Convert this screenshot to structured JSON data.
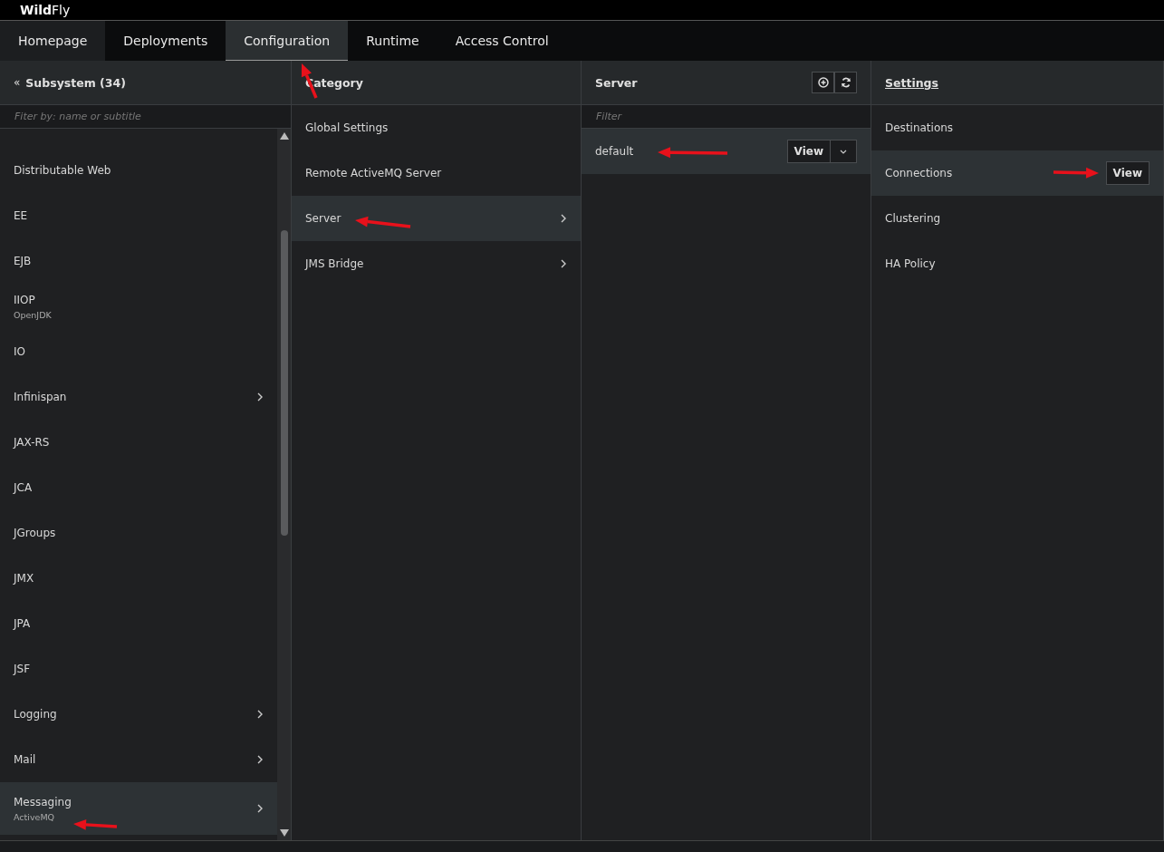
{
  "brand": {
    "strong": "Wild",
    "light": "Fly"
  },
  "tabs": [
    {
      "label": "Homepage",
      "selected": false
    },
    {
      "label": "Deployments",
      "selected": false
    },
    {
      "label": "Configuration",
      "selected": true
    },
    {
      "label": "Runtime",
      "selected": false
    },
    {
      "label": "Access Control",
      "selected": false
    }
  ],
  "subsystem_column": {
    "back": "«",
    "title": "Subsystem (34)",
    "filter_placeholder": "Fiter by: name or subtitle",
    "items": [
      {
        "label": "Distributable Web",
        "has_children": false,
        "selected": false
      },
      {
        "label": "EE",
        "has_children": false,
        "selected": false
      },
      {
        "label": "EJB",
        "has_children": false,
        "selected": false
      },
      {
        "label": "IIOP",
        "subtitle": "OpenJDK",
        "has_children": false,
        "selected": false
      },
      {
        "label": "IO",
        "has_children": false,
        "selected": false
      },
      {
        "label": "Infinispan",
        "has_children": true,
        "selected": false
      },
      {
        "label": "JAX-RS",
        "has_children": false,
        "selected": false
      },
      {
        "label": "JCA",
        "has_children": false,
        "selected": false
      },
      {
        "label": "JGroups",
        "has_children": false,
        "selected": false
      },
      {
        "label": "JMX",
        "has_children": false,
        "selected": false
      },
      {
        "label": "JPA",
        "has_children": false,
        "selected": false
      },
      {
        "label": "JSF",
        "has_children": false,
        "selected": false
      },
      {
        "label": "Logging",
        "has_children": true,
        "selected": false
      },
      {
        "label": "Mail",
        "has_children": true,
        "selected": false
      },
      {
        "label": "Messaging",
        "subtitle": "ActiveMQ",
        "has_children": true,
        "selected": true
      }
    ]
  },
  "category_column": {
    "title": "Category",
    "items": [
      {
        "label": "Global Settings",
        "has_children": false,
        "selected": false
      },
      {
        "label": "Remote ActiveMQ Server",
        "has_children": false,
        "selected": false
      },
      {
        "label": "Server",
        "has_children": true,
        "selected": true
      },
      {
        "label": "JMS Bridge",
        "has_children": true,
        "selected": false
      }
    ]
  },
  "server_column": {
    "title": "Server",
    "filter_placeholder": "Filter",
    "items": [
      {
        "label": "default",
        "action": "View",
        "selected": true
      }
    ]
  },
  "settings_column": {
    "title": "Settings",
    "items": [
      {
        "label": "Destinations",
        "selected": false
      },
      {
        "label": "Connections",
        "action": "View",
        "selected": true
      },
      {
        "label": "Clustering",
        "selected": false
      },
      {
        "label": "HA Policy",
        "selected": false
      }
    ]
  }
}
